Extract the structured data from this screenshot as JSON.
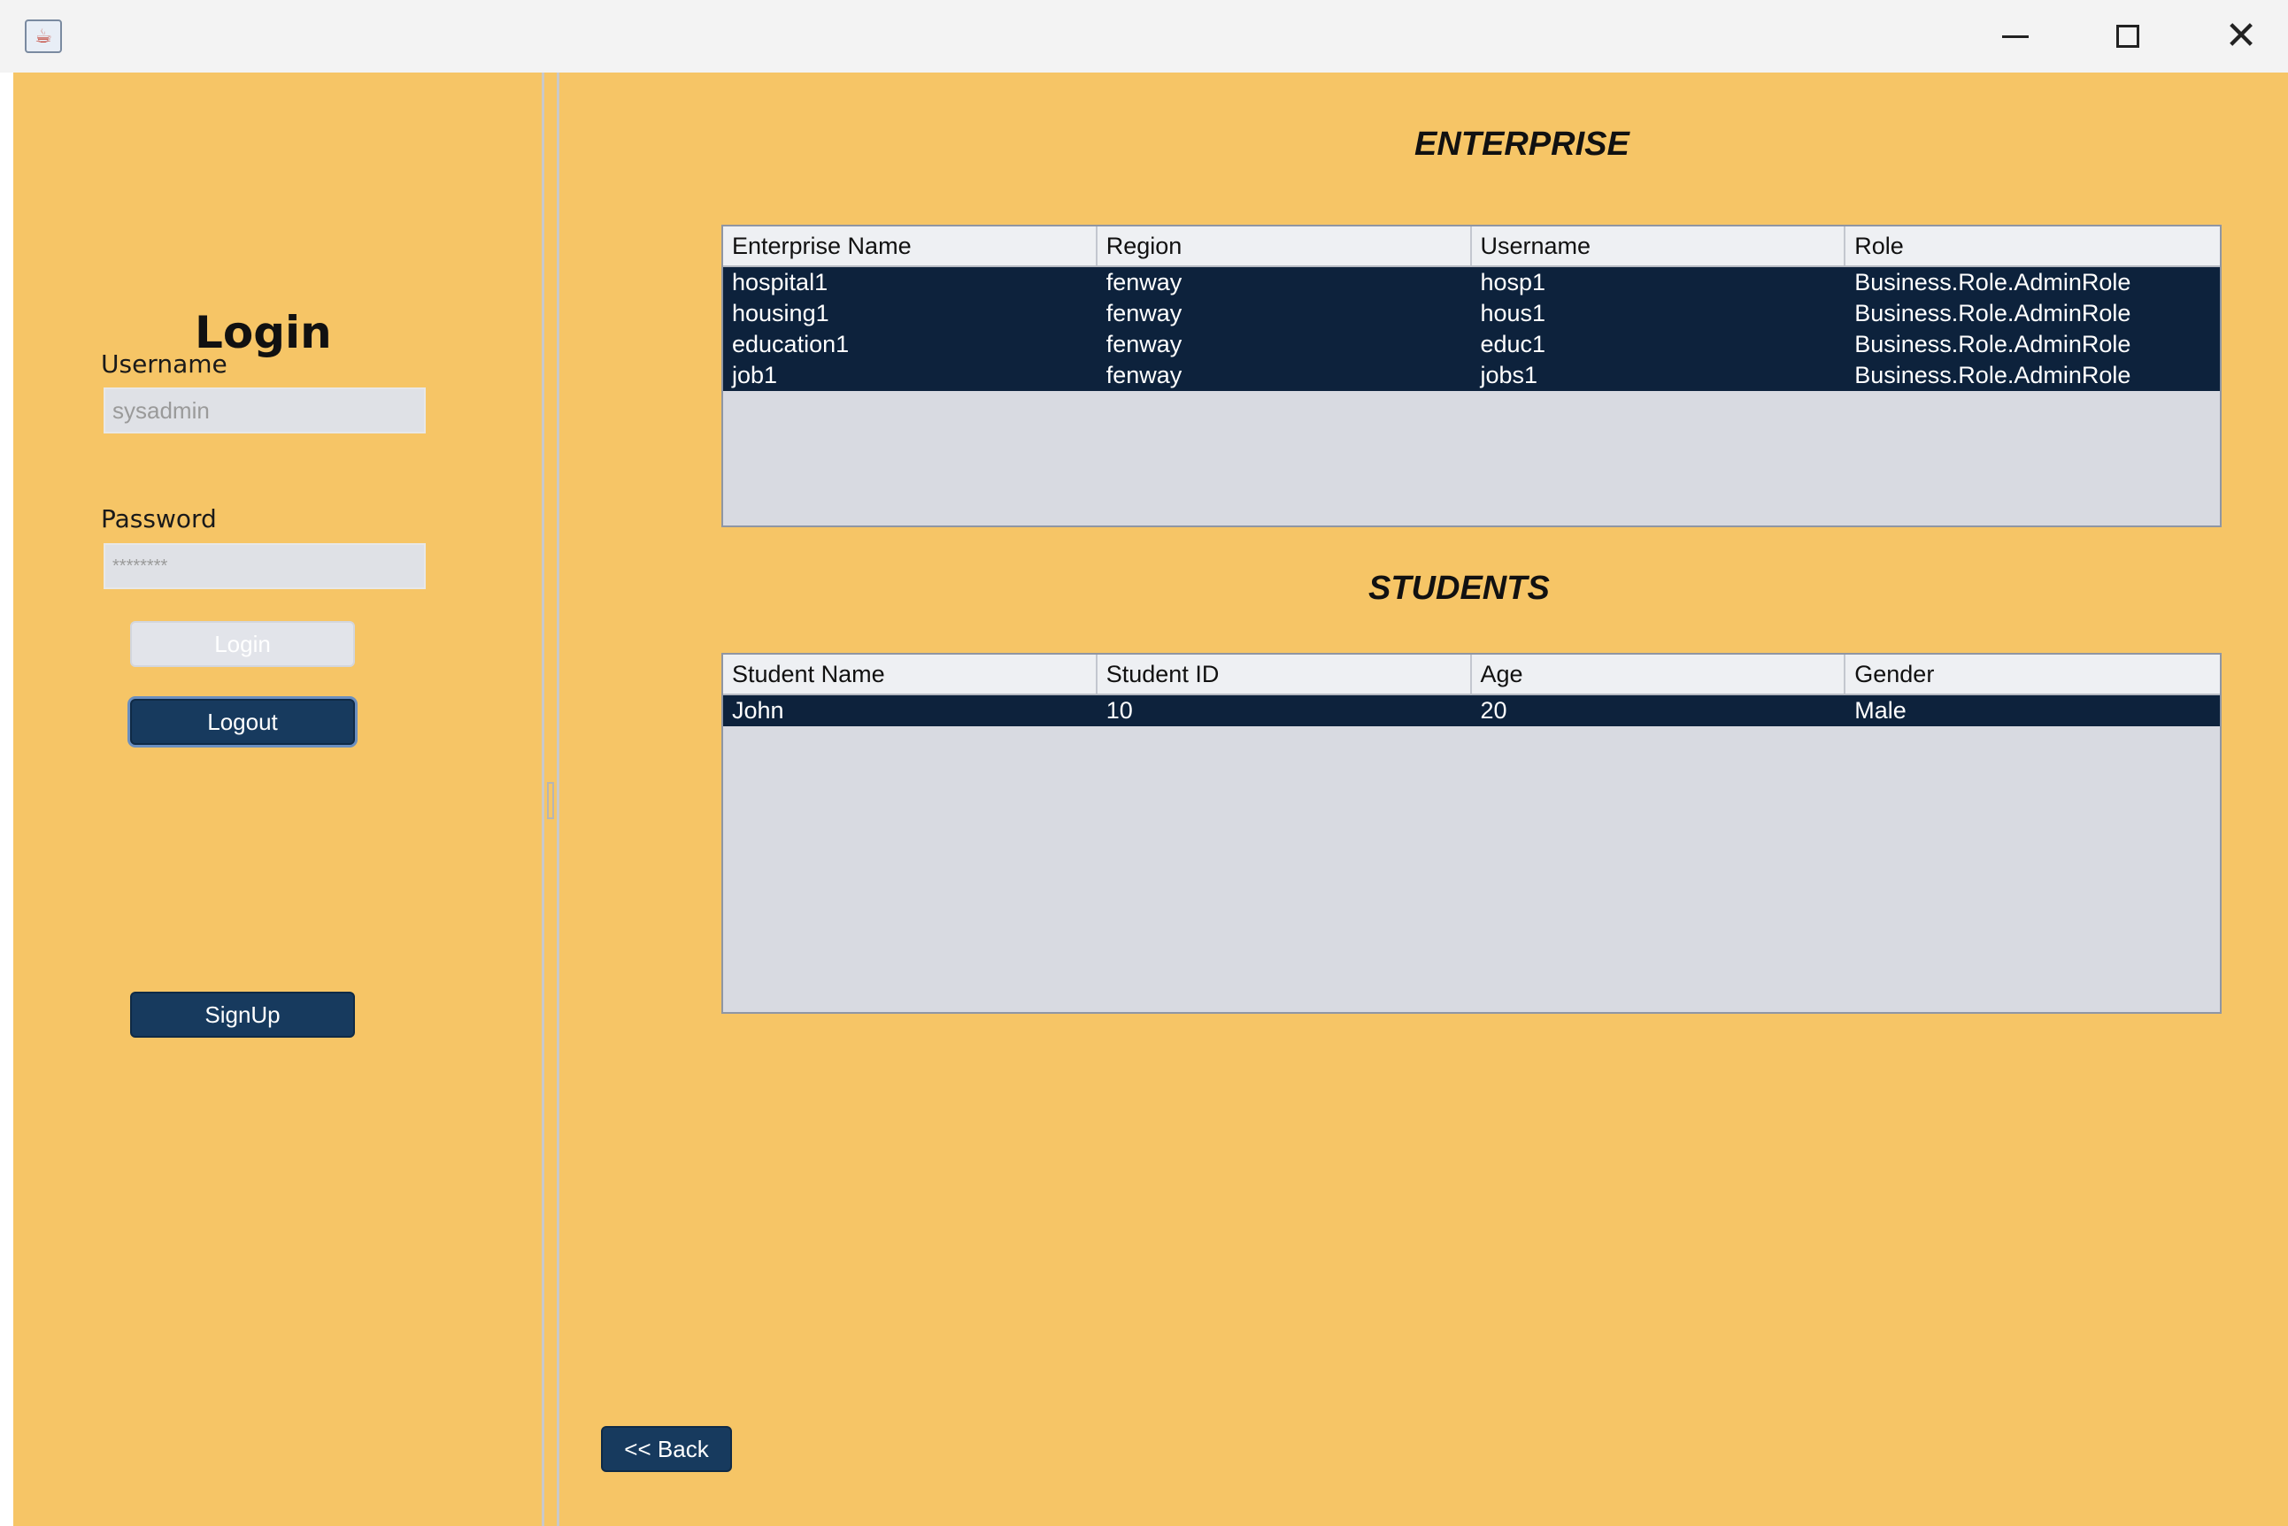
{
  "window": {
    "icon": "java-cup-icon",
    "controls": {
      "minimize": "minimize-icon",
      "maximize": "maximize-icon",
      "close": "close-icon"
    }
  },
  "login_panel": {
    "title": "Login",
    "username_label": "Username",
    "username_value": "sysadmin",
    "password_label": "Password",
    "password_value": "********",
    "login_button": "Login",
    "logout_button": "Logout",
    "signup_button": "SignUp"
  },
  "enterprise": {
    "title": "ENTERPRISE",
    "columns": [
      "Enterprise Name",
      "Region",
      "Username",
      "Role"
    ],
    "rows": [
      [
        "hospital1",
        "fenway",
        "hosp1",
        "Business.Role.AdminRole"
      ],
      [
        "housing1",
        "fenway",
        "hous1",
        "Business.Role.AdminRole"
      ],
      [
        "education1",
        "fenway",
        "educ1",
        "Business.Role.AdminRole"
      ],
      [
        "job1",
        "fenway",
        "jobs1",
        "Business.Role.AdminRole"
      ]
    ]
  },
  "students": {
    "title": "STUDENTS",
    "columns": [
      "Student Name",
      "Student ID",
      "Age",
      "Gender"
    ],
    "rows": [
      [
        "John",
        "10",
        "20",
        "Male"
      ]
    ]
  },
  "back_button": "<< Back",
  "colors": {
    "panel_bg": "#f6c566",
    "button_navy": "#173a5e",
    "selected_row": "#0d223c",
    "table_bg": "#d8dae1"
  }
}
